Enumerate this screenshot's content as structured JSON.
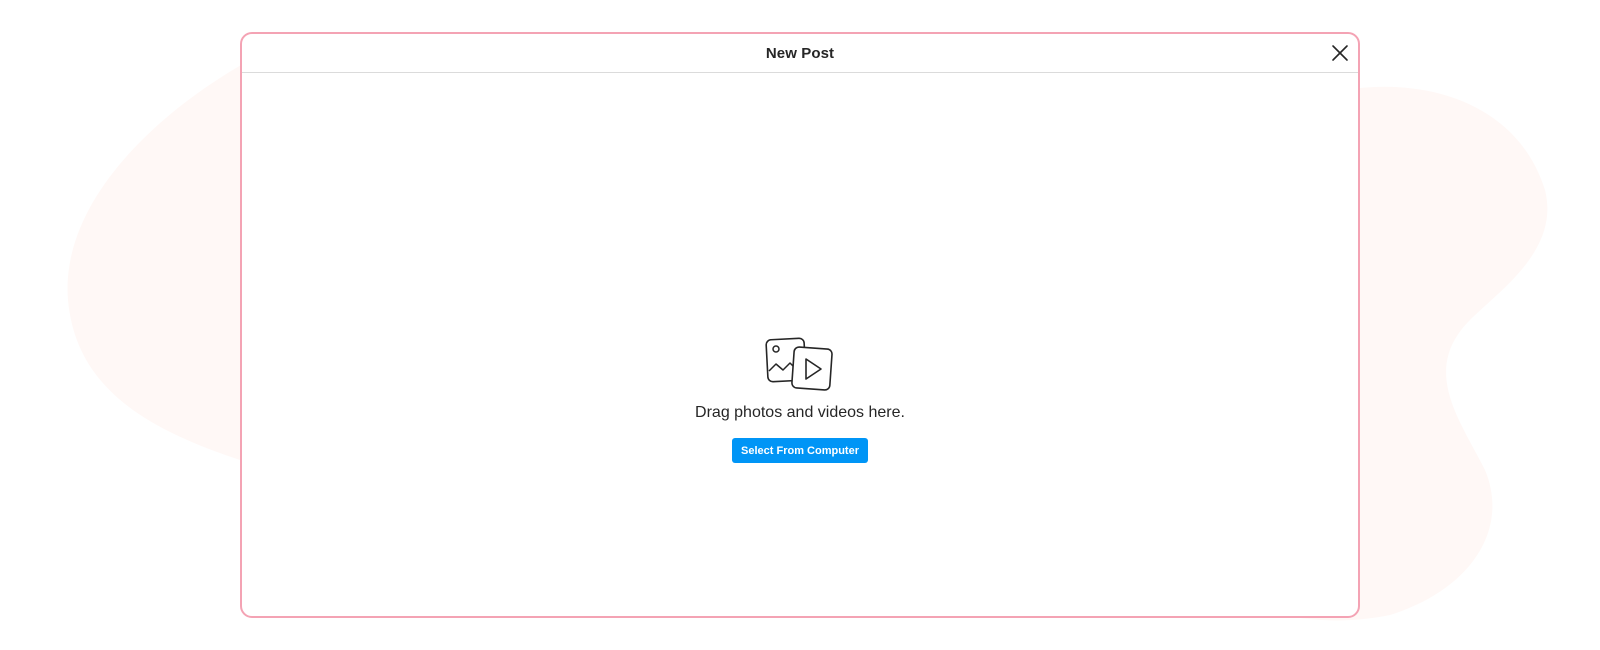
{
  "modal": {
    "title": "New Post",
    "close_icon": "close-icon",
    "upload": {
      "icon": "photo-video-icon",
      "prompt": "Drag photos and videos here.",
      "select_button_label": "Select From Computer"
    }
  },
  "colors": {
    "accent": "#0095f6",
    "modal_border": "#f4a3b4",
    "background_blob": "#fff8f6",
    "text": "#262626",
    "divider": "#dbdbdb"
  }
}
